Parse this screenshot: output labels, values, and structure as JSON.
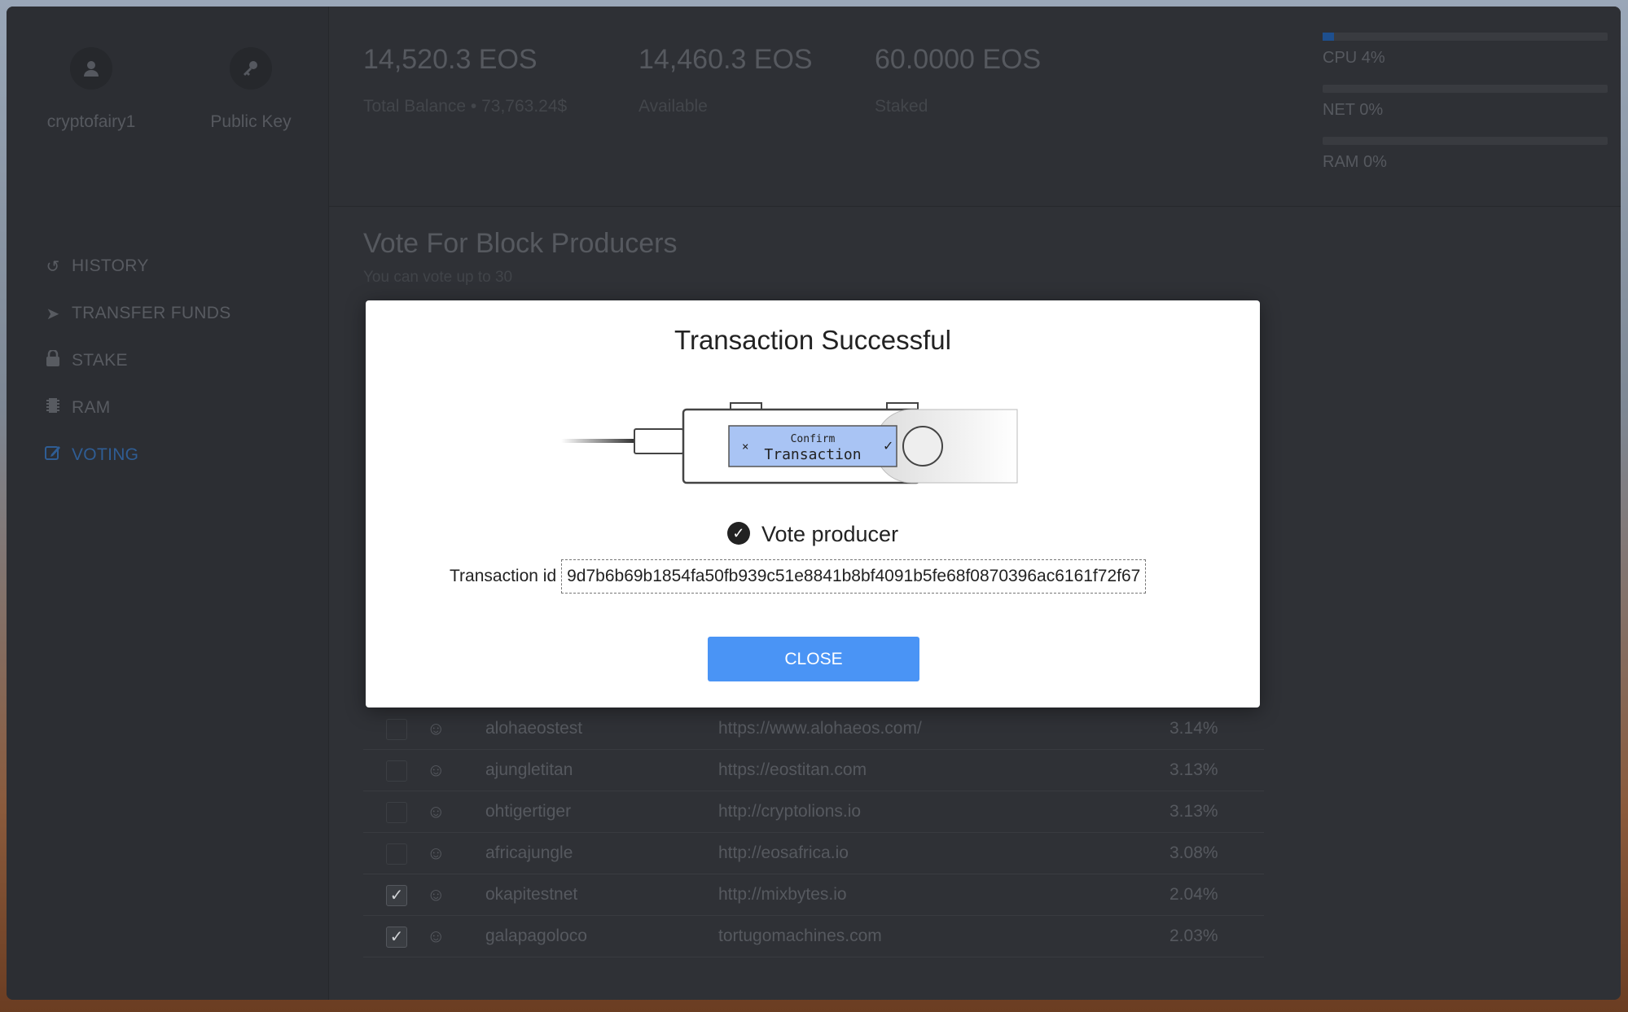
{
  "window": {
    "sidebar": {
      "account_name": "cryptofairy1",
      "public_key_label": "Public Key",
      "nav": [
        {
          "label": "HISTORY",
          "icon": "history-icon"
        },
        {
          "label": "TRANSFER FUNDS",
          "icon": "send-icon"
        },
        {
          "label": "STAKE",
          "icon": "lock-icon"
        },
        {
          "label": "RAM",
          "icon": "chip-icon"
        },
        {
          "label": "VOTING",
          "icon": "edit-icon",
          "active": true
        }
      ]
    },
    "stats": {
      "total": {
        "value": "14,520.3 EOS",
        "label": "Total Balance • 73,763.24$"
      },
      "available": {
        "value": "14,460.3 EOS",
        "label": "Available"
      },
      "staked": {
        "value": "60.0000 EOS",
        "label": "Staked"
      }
    },
    "resources": [
      {
        "label": "CPU 4%",
        "percent": 4
      },
      {
        "label": "NET 0%",
        "percent": 0
      },
      {
        "label": "RAM 0%",
        "percent": 0
      }
    ],
    "voting": {
      "title": "Vote For Block Producers",
      "subtitle": "You can vote up to 30",
      "rows": [
        {
          "name": "alohaeostest",
          "url": "https://www.alohaeos.com/",
          "pct": "3.14%",
          "checked": false
        },
        {
          "name": "ajungletitan",
          "url": "https://eostitan.com",
          "pct": "3.13%",
          "checked": false
        },
        {
          "name": "ohtigertiger",
          "url": "http://cryptolions.io",
          "pct": "3.13%",
          "checked": false
        },
        {
          "name": "africajungle",
          "url": "http://eosafrica.io",
          "pct": "3.08%",
          "checked": false
        },
        {
          "name": "okapitestnet",
          "url": "http://mixbytes.io",
          "pct": "2.04%",
          "checked": true
        },
        {
          "name": "galapagoloco",
          "url": "tortugomachines.com",
          "pct": "2.03%",
          "checked": true
        }
      ]
    }
  },
  "modal": {
    "title": "Transaction Successful",
    "device_screen": {
      "top": "Confirm",
      "main": "Transaction"
    },
    "status": "Vote producer",
    "tx_label": "Transaction id",
    "tx_id": "9d7b6b69b1854fa50fb939c51e8841b8bf4091b5fe68f0870396ac6161f72f67",
    "close_label": "CLOSE"
  },
  "colors": {
    "accent": "#4a94f5",
    "active_nav": "#2f5d94",
    "cpu_bar": "#1e4f8e"
  }
}
